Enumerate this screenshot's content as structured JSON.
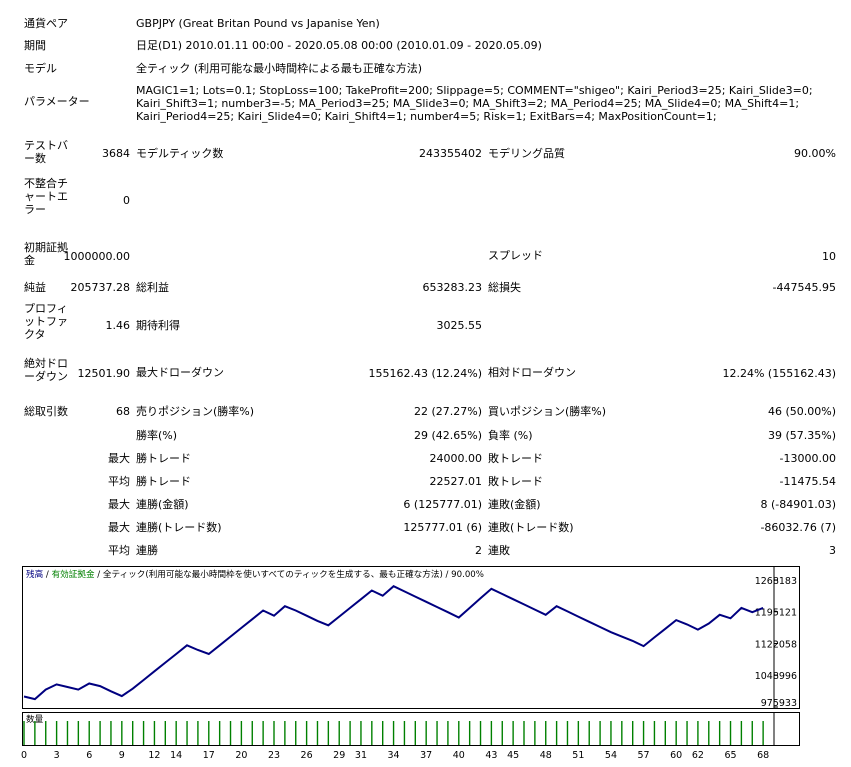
{
  "header_rows": [
    {
      "label": "通貨ペア",
      "value": "GBPJPY (Great Britan Pound vs Japanise Yen)"
    },
    {
      "label": "期間",
      "value": "日足(D1) 2010.01.11 00:00 - 2020.05.08 00:00 (2010.01.09 - 2020.05.09)"
    },
    {
      "label": "モデル",
      "value": "全ティック (利用可能な最小時間枠による最も正確な方法)"
    },
    {
      "label": "パラメーター",
      "value": "MAGIC1=1; Lots=0.1; StopLoss=100; TakeProfit=200; Slippage=5; COMMENT=\"shigeo\"; Kairi_Period3=25; Kairi_Slide3=0; Kairi_Shift3=1; number3=-5; MA_Period3=25; MA_Slide3=0; MA_Shift3=2; MA_Period4=25; MA_Slide4=0; MA_Shift4=1; Kairi_Period4=25; Kairi_Slide4=0; Kairi_Shift4=1; number4=5; Risk=1; ExitBars=4; MaxPositionCount=1;"
    }
  ],
  "stats": {
    "bars_label": "テストバー数",
    "bars_value": "3684",
    "ticks_label": "モデルティック数",
    "ticks_value": "243355402",
    "quality_label": "モデリング品質",
    "quality_value": "90.00%",
    "mismatch_label": "不整合チャートエラー",
    "mismatch_value": "0",
    "deposit_label": "初期証拠金",
    "deposit_value": "1000000.00",
    "spread_label": "スプレッド",
    "spread_value": "10",
    "net_label": "純益",
    "net_value": "205737.28",
    "gross_profit_label": "総利益",
    "gross_profit_value": "653283.23",
    "gross_loss_label": "総損失",
    "gross_loss_value": "-447545.95",
    "pf_label": "プロフィットファクタ",
    "pf_value": "1.46",
    "expected_label": "期待利得",
    "expected_value": "3025.55",
    "abs_dd_label": "絶対ドローダウン",
    "abs_dd_value": "12501.90",
    "max_dd_label": "最大ドローダウン",
    "max_dd_value": "155162.43 (12.24%)",
    "rel_dd_label": "相対ドローダウン",
    "rel_dd_value": "12.24% (155162.43)",
    "total_trades_label": "総取引数",
    "total_trades_value": "68",
    "short_label": "売りポジション(勝率%)",
    "short_value": "22 (27.27%)",
    "long_label": "買いポジション(勝率%)",
    "long_value": "46 (50.00%)"
  },
  "detail_rows": [
    {
      "prefix": "",
      "l_label": "勝率(%)",
      "l_value": "29 (42.65%)",
      "r_label": "負率 (%)",
      "r_value": "39 (57.35%)"
    },
    {
      "prefix": "最大",
      "l_label": "勝トレード",
      "l_value": "24000.00",
      "r_label": "敗トレード",
      "r_value": "-13000.00"
    },
    {
      "prefix": "平均",
      "l_label": "勝トレード",
      "l_value": "22527.01",
      "r_label": "敗トレード",
      "r_value": "-11475.54"
    },
    {
      "prefix": "最大",
      "l_label": "連勝(金額)",
      "l_value": "6 (125777.01)",
      "r_label": "連敗(金額)",
      "r_value": "8 (-84901.03)"
    },
    {
      "prefix": "最大",
      "l_label": "連勝(トレード数)",
      "l_value": "125777.01 (6)",
      "r_label": "連敗(トレード数)",
      "r_value": "-86032.76 (7)"
    },
    {
      "prefix": "平均",
      "l_label": "連勝",
      "l_value": "2",
      "r_label": "連敗",
      "r_value": "3"
    }
  ],
  "chart_data": {
    "type": "line",
    "header_parts": [
      "残高",
      " / ",
      "有効証拠金",
      " / ",
      "全ティック(利用可能な最小時間枠を使いすべてのティックを生成する、最も正確な方法)",
      " / ",
      "90.00%"
    ],
    "header_colors": [
      "#000080",
      "#000000",
      "#008000",
      "#000000",
      "#000000",
      "#000000",
      "#000000"
    ],
    "line_color": "#000080",
    "y_ticks": [
      "1268183",
      "1195121",
      "1122058",
      "1048996",
      "975933"
    ],
    "y_tick_values": [
      1268183,
      1195121,
      1122058,
      1048996,
      975933
    ],
    "ylim": [
      975933,
      1268183
    ],
    "x_ticks": [
      "0",
      "3",
      "6",
      "9",
      "12",
      "14",
      "17",
      "20",
      "23",
      "26",
      "29",
      "31",
      "34",
      "37",
      "40",
      "43",
      "45",
      "48",
      "51",
      "54",
      "57",
      "60",
      "62",
      "65",
      "68"
    ],
    "x_tick_values": [
      0,
      3,
      6,
      9,
      12,
      14,
      17,
      20,
      23,
      26,
      29,
      31,
      34,
      37,
      40,
      43,
      45,
      48,
      51,
      54,
      57,
      60,
      62,
      65,
      68
    ],
    "xlim": [
      0,
      69
    ],
    "x": [
      0,
      1,
      2,
      3,
      4,
      5,
      6,
      7,
      8,
      9,
      10,
      11,
      12,
      13,
      14,
      15,
      16,
      17,
      18,
      19,
      20,
      21,
      22,
      23,
      24,
      25,
      26,
      27,
      28,
      29,
      30,
      31,
      32,
      33,
      34,
      35,
      36,
      37,
      38,
      39,
      40,
      41,
      42,
      43,
      44,
      45,
      46,
      47,
      48,
      49,
      50,
      51,
      52,
      53,
      54,
      55,
      56,
      57,
      58,
      59,
      60,
      61,
      62,
      63,
      64,
      65,
      66,
      67,
      68
    ],
    "balance": [
      1000000,
      994000,
      1016000,
      1028000,
      1022000,
      1016000,
      1030000,
      1024000,
      1012000,
      1001000,
      1018000,
      1038000,
      1058000,
      1078000,
      1098000,
      1118000,
      1107000,
      1098000,
      1118000,
      1138000,
      1158000,
      1178000,
      1198000,
      1186000,
      1208000,
      1198000,
      1186000,
      1174000,
      1164000,
      1184000,
      1204000,
      1224000,
      1244000,
      1232000,
      1254000,
      1242000,
      1230000,
      1218000,
      1206000,
      1194000,
      1182000,
      1204000,
      1226000,
      1248000,
      1236000,
      1224000,
      1212000,
      1200000,
      1188000,
      1208000,
      1196000,
      1184000,
      1172000,
      1160000,
      1148000,
      1138000,
      1128000,
      1116000,
      1136000,
      1156000,
      1176000,
      1166000,
      1154000,
      1168000,
      1188000,
      1180000,
      1204000,
      1194000,
      1204000
    ],
    "volume_label": "数量",
    "volume_color": "#008000"
  }
}
